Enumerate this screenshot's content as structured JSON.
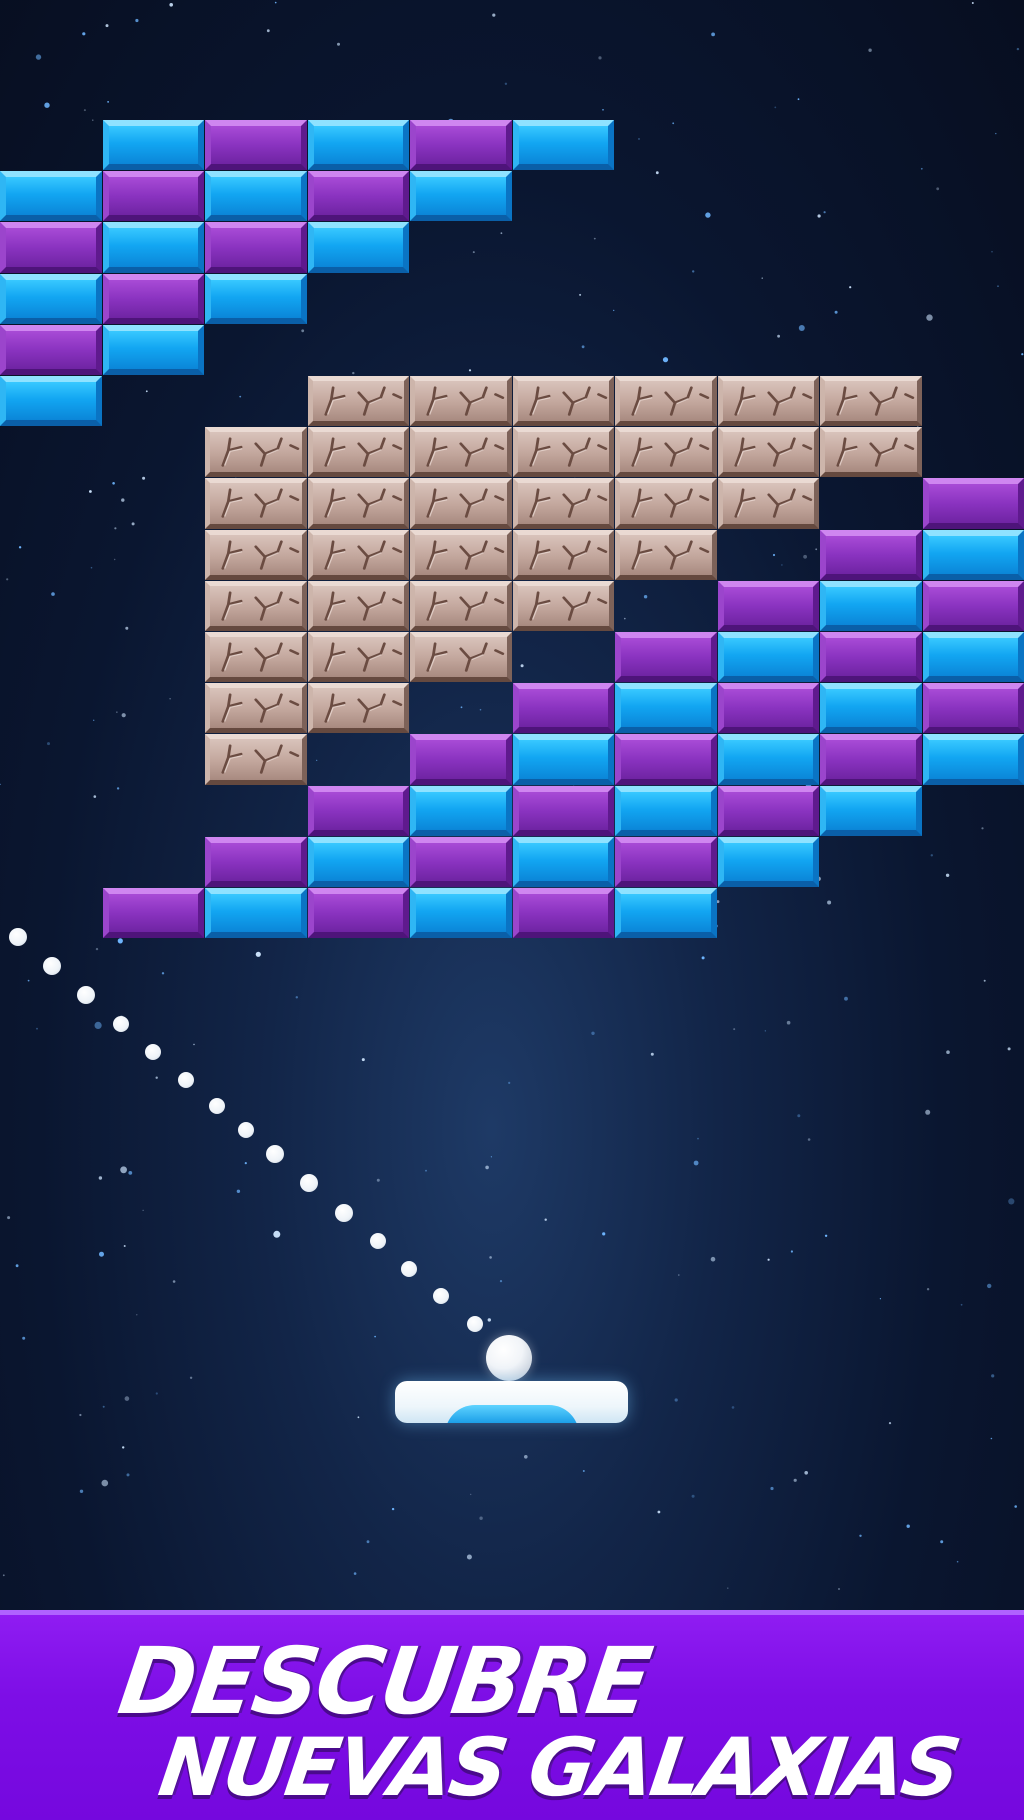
{
  "banner": {
    "line1": "DESCUBRE",
    "line2": "NUEVAS GALAXIAS"
  },
  "colors": {
    "brick_blue": "#12a6f2",
    "brick_purple": "#8a33c0",
    "brick_stone": "#c2a69c",
    "banner": "#7d0ee6",
    "background": "#0a1630"
  },
  "bricks": {
    "rows": [
      [
        "",
        "B",
        "P",
        "B",
        "P",
        "B",
        "",
        "",
        "",
        ""
      ],
      [
        "B",
        "P",
        "B",
        "P",
        "B",
        "",
        "",
        "",
        "",
        ""
      ],
      [
        "P",
        "B",
        "P",
        "B",
        "",
        "",
        "",
        "",
        "",
        ""
      ],
      [
        "B",
        "P",
        "B",
        "",
        "",
        "",
        "",
        "",
        "",
        ""
      ],
      [
        "P",
        "B",
        "",
        "",
        "",
        "",
        "",
        "",
        "",
        ""
      ],
      [
        "B",
        "",
        "",
        "S",
        "S",
        "S",
        "S",
        "S",
        "S",
        ""
      ],
      [
        "",
        "",
        "S",
        "S",
        "S",
        "S",
        "S",
        "S",
        "S",
        ""
      ],
      [
        "",
        "",
        "S",
        "S",
        "S",
        "S",
        "S",
        "S",
        "",
        "P"
      ],
      [
        "",
        "",
        "S",
        "S",
        "S",
        "S",
        "S",
        "",
        "P",
        "B"
      ],
      [
        "",
        "",
        "S",
        "S",
        "S",
        "S",
        "",
        "P",
        "B",
        "P"
      ],
      [
        "",
        "",
        "S",
        "S",
        "S",
        "",
        "P",
        "B",
        "P",
        "B"
      ],
      [
        "",
        "",
        "S",
        "S",
        "",
        "P",
        "B",
        "P",
        "B",
        "P"
      ],
      [
        "",
        "",
        "S",
        "",
        "P",
        "B",
        "P",
        "B",
        "P",
        "B"
      ],
      [
        "",
        "",
        "",
        "P",
        "B",
        "P",
        "B",
        "P",
        "B",
        ""
      ],
      [
        "",
        "",
        "P",
        "B",
        "P",
        "B",
        "P",
        "B",
        "",
        ""
      ],
      [
        "",
        "P",
        "B",
        "P",
        "B",
        "P",
        "B",
        "",
        "",
        ""
      ]
    ]
  }
}
